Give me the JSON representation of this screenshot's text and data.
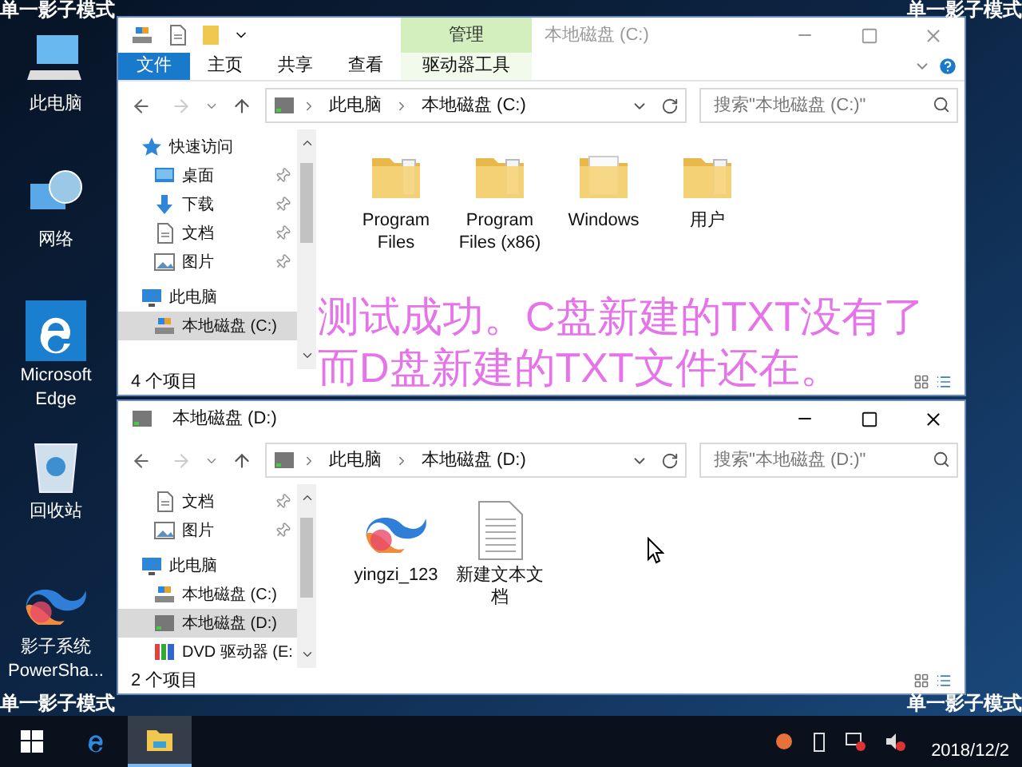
{
  "corner_labels": [
    "单一影子模式",
    "单一影子模式",
    "单一影子模式",
    "单一影子模式"
  ],
  "desktop_icons": [
    {
      "label": "此电脑",
      "kind": "computer"
    },
    {
      "label": "网络",
      "kind": "network"
    },
    {
      "label": "Microsoft Edge",
      "kind": "edge"
    },
    {
      "label": "回收站",
      "kind": "recycle"
    },
    {
      "label": "影子系统 PowerSha...",
      "kind": "swirl"
    }
  ],
  "windows": [
    {
      "title": "本地磁盘 (C:)",
      "active": false,
      "ribbon": {
        "context_label": "管理",
        "tabs": [
          {
            "label": "文件",
            "kind": "file"
          },
          {
            "label": "主页",
            "kind": "tab"
          },
          {
            "label": "共享",
            "kind": "tab"
          },
          {
            "label": "查看",
            "kind": "tab"
          },
          {
            "label": "驱动器工具",
            "kind": "context"
          }
        ]
      },
      "crumbs": [
        "此电脑",
        "本地磁盘 (C:)"
      ],
      "search": {
        "placeholder": "搜索\"本地磁盘 (C:)\""
      },
      "sidebar": [
        {
          "label": "快速访问",
          "kind": "star",
          "children": [
            {
              "label": "桌面",
              "kind": "desktop",
              "pinned": true,
              "selected": false
            },
            {
              "label": "下载",
              "kind": "download",
              "pinned": true,
              "selected": false
            },
            {
              "label": "文档",
              "kind": "document",
              "pinned": true,
              "selected": false
            },
            {
              "label": "图片",
              "kind": "picture",
              "pinned": true,
              "selected": false
            }
          ]
        },
        {
          "label": "此电脑",
          "kind": "pc",
          "children": [
            {
              "label": "本地磁盘 (C:)",
              "kind": "drive-system",
              "pinned": false,
              "selected": true
            }
          ]
        }
      ],
      "files": [
        {
          "label": "Program Files",
          "kind": "folder"
        },
        {
          "label": "Program Files (x86)",
          "kind": "folder"
        },
        {
          "label": "Windows",
          "kind": "folder-papers"
        },
        {
          "label": "用户",
          "kind": "folder"
        }
      ],
      "status": "4 个项目"
    },
    {
      "title": "本地磁盘 (D:)",
      "active": true,
      "crumbs": [
        "此电脑",
        "本地磁盘 (D:)"
      ],
      "search": {
        "placeholder": "搜索\"本地磁盘 (D:)\""
      },
      "sidebar": [
        {
          "children": [
            {
              "label": "文档",
              "kind": "document",
              "pinned": true,
              "selected": false
            },
            {
              "label": "图片",
              "kind": "picture",
              "pinned": true,
              "selected": false
            }
          ]
        },
        {
          "label": "此电脑",
          "kind": "pc",
          "children": [
            {
              "label": "本地磁盘 (C:)",
              "kind": "drive-system",
              "pinned": false,
              "selected": false
            },
            {
              "label": "本地磁盘 (D:)",
              "kind": "drive",
              "pinned": false,
              "selected": true
            },
            {
              "label": "DVD 驱动器 (E:",
              "kind": "dvd",
              "pinned": false,
              "selected": false
            }
          ]
        }
      ],
      "files": [
        {
          "label": "yingzi_123",
          "kind": "swirl"
        },
        {
          "label": "新建文本文档",
          "kind": "text-file"
        }
      ],
      "status": "2 个项目"
    }
  ],
  "annotation": [
    "测试成功。C盘新建的TXT没有了",
    "而D盘新建的TXT文件还在。"
  ],
  "taskbar": {
    "apps": [
      {
        "kind": "start",
        "selected": false
      },
      {
        "kind": "edge",
        "selected": false
      },
      {
        "kind": "explorer",
        "selected": true
      }
    ],
    "date": "2018/12/2"
  }
}
